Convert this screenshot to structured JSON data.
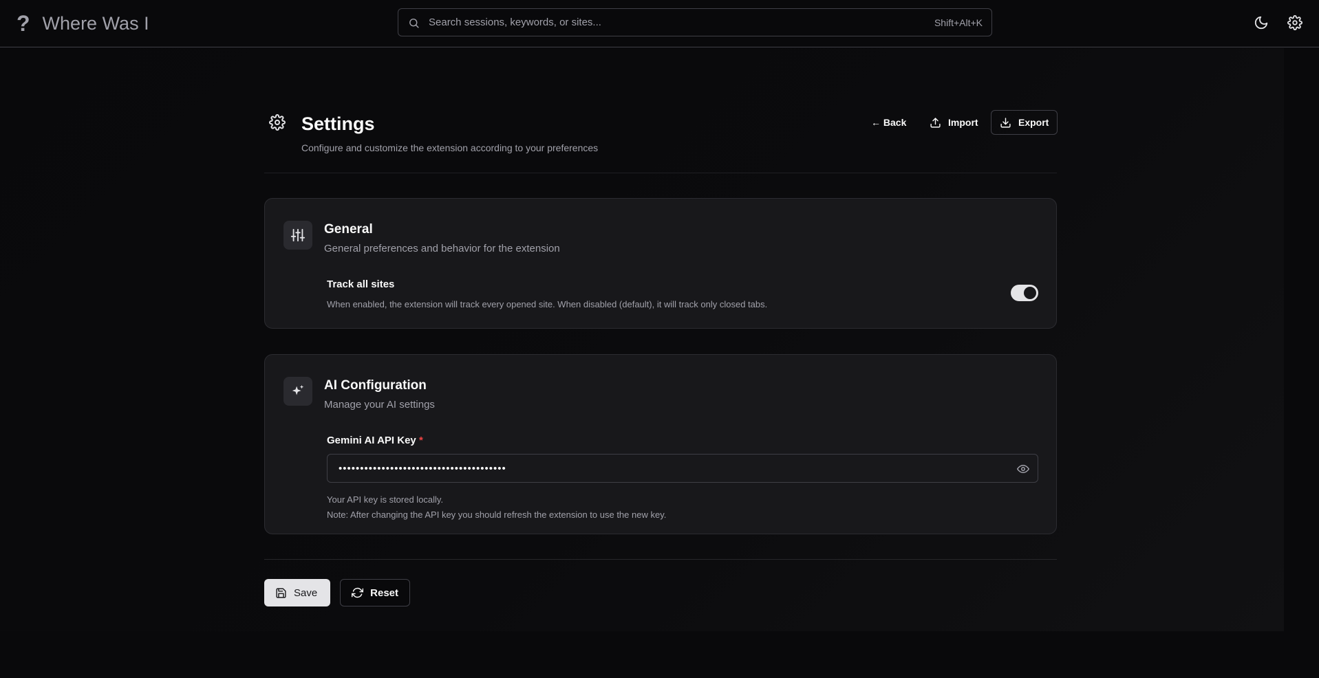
{
  "app": {
    "logo_glyph": "?",
    "title": "Where Was I"
  },
  "search": {
    "placeholder": "Search sessions, keywords, or sites...",
    "value": "",
    "shortcut": "Shift+Alt+K"
  },
  "header_icons": [
    "moon-icon",
    "gear-icon"
  ],
  "page": {
    "title": "Settings",
    "subtitle": "Configure and customize the extension according to your preferences",
    "actions": {
      "back": "← Back",
      "import": "Import",
      "export": "Export"
    }
  },
  "general": {
    "title": "General",
    "description": "General preferences and behavior for the extension",
    "track_all": {
      "label": "Track all sites",
      "help": "When enabled, the extension will track every opened site. When disabled (default), it will track only closed tabs.",
      "enabled": true
    }
  },
  "ai": {
    "title": "AI Configuration",
    "description": "Manage your AI settings",
    "api_key": {
      "label": "Gemini AI API Key",
      "required_mark": "*",
      "value": "•••••••••••••••••••••••••••••••••••••••",
      "help_1": "Your API key is stored locally.",
      "help_2": "Note: After changing the API key you should refresh the extension to use the new key."
    }
  },
  "footer": {
    "save": "Save",
    "reset": "Reset"
  },
  "colors": {
    "background": "#09090b",
    "card": "#18181b",
    "border": "#3f3f46",
    "muted_text": "#a1a1aa",
    "required": "#ef4444"
  }
}
